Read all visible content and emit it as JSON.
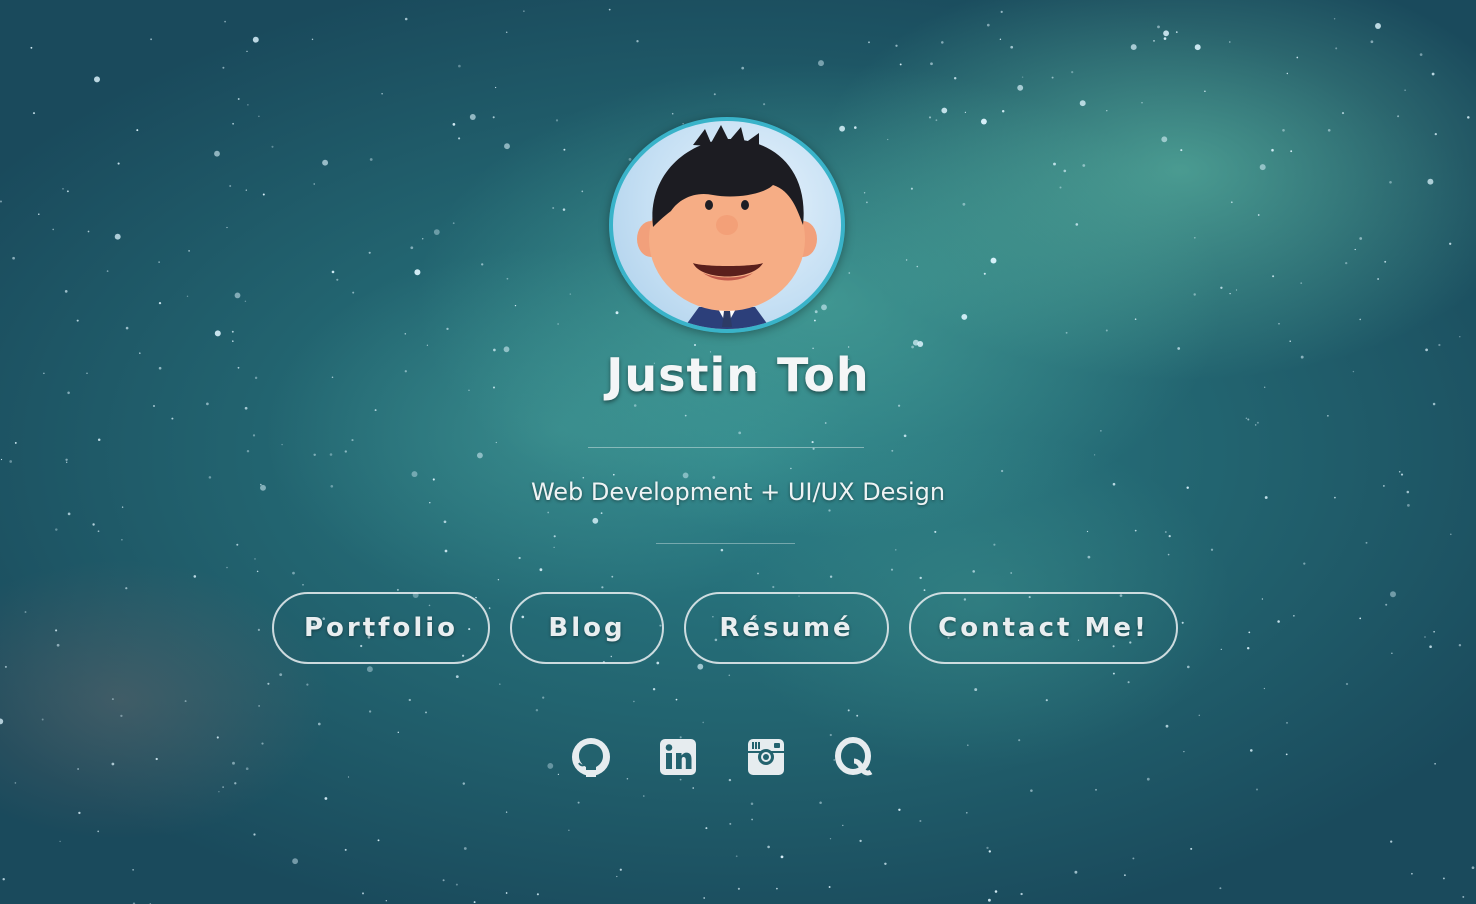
{
  "profile": {
    "name": "Justin Toh",
    "tagline": "Web Development + UI/UX Design"
  },
  "nav": {
    "portfolio_label": "Portfolio",
    "blog_label": "Blog",
    "resume_label": "Résumé",
    "contact_label": "Contact Me!"
  },
  "social": [
    {
      "icon": "github-icon"
    },
    {
      "icon": "linkedin-icon"
    },
    {
      "icon": "instagram-icon"
    },
    {
      "icon": "quora-icon"
    }
  ],
  "colors": {
    "avatar_border": "#39b3c9",
    "background": "#22636f",
    "text": "#e9eef0"
  }
}
